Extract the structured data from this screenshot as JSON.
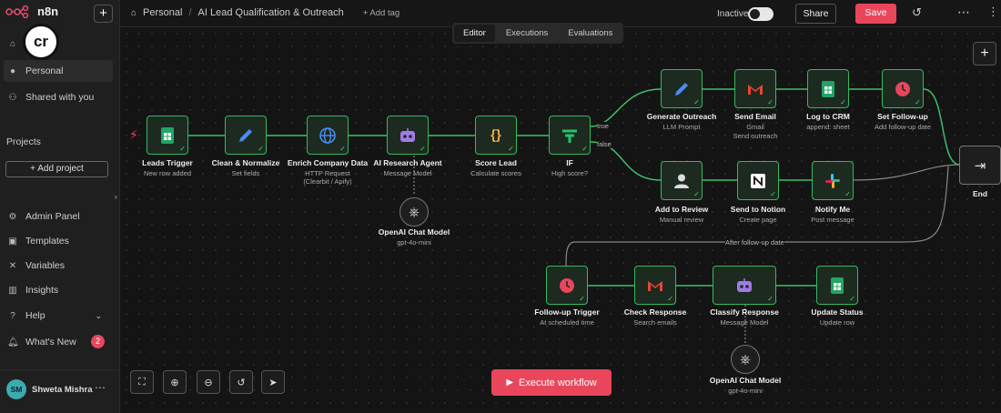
{
  "app": {
    "brand": "n8n",
    "avatar_initials": "cr"
  },
  "sidebar": {
    "items": [
      {
        "label": "",
        "icon": "home-icon"
      },
      {
        "label": "Personal",
        "icon": "user-icon"
      },
      {
        "label": "Shared with you",
        "icon": "users-icon"
      }
    ],
    "projects_heading": "Projects",
    "add_project": "+ Add project",
    "bottom_items": [
      {
        "label": "Admin Panel",
        "icon": "gear-icon"
      },
      {
        "label": "Templates",
        "icon": "template-icon"
      },
      {
        "label": "Variables",
        "icon": "variables-icon"
      },
      {
        "label": "Insights",
        "icon": "insights-icon"
      },
      {
        "label": "Help",
        "icon": "help-icon"
      },
      {
        "label": "What's New",
        "icon": "bell-icon"
      }
    ],
    "whats_new_count": "2",
    "user": {
      "initials": "SM",
      "name": "Shweta Mishra"
    }
  },
  "header": {
    "breadcrumb_project": "Personal",
    "breadcrumb_sep": "/",
    "workflow_name": "AI Lead Qualification & Outreach",
    "add_tag": "+ Add tag",
    "status": "Inactive",
    "share": "Share",
    "save": "Save"
  },
  "tabs": [
    "Editor",
    "Executions",
    "Evaluations"
  ],
  "nodes": [
    {
      "id": "leads",
      "label": "Leads Trigger",
      "sub": "New row added",
      "icon": "sheets-icon"
    },
    {
      "id": "clean",
      "label": "Clean & Normalize",
      "sub": "Set fields",
      "icon": "pencil-icon"
    },
    {
      "id": "enrich",
      "label": "Enrich Company Data",
      "sub": "HTTP Request",
      "sub2": "(Clearbit / Apify)",
      "icon": "globe-icon"
    },
    {
      "id": "agent",
      "label": "AI Research Agent",
      "sub": "Message Model",
      "icon": "robot-icon"
    },
    {
      "id": "score",
      "label": "Score Lead",
      "sub": "Calculate scores",
      "icon": "code-icon"
    },
    {
      "id": "if",
      "label": "IF",
      "sub": "High score?",
      "icon": "if-icon"
    },
    {
      "id": "gen",
      "label": "Generate Outreach",
      "sub": "LLM Prompt",
      "icon": "pencil-icon"
    },
    {
      "id": "email",
      "label": "Send Email",
      "sub": "Gmail",
      "sub2": "Send outreach",
      "icon": "gmail-icon"
    },
    {
      "id": "crm",
      "label": "Log to CRM",
      "sub": "append: sheet",
      "icon": "sheets-icon"
    },
    {
      "id": "follow",
      "label": "Set Follow-up",
      "sub": "Add follow-up date",
      "icon": "clock-icon"
    },
    {
      "id": "review",
      "label": "Add to Review",
      "sub": "Manual review",
      "icon": "person-icon"
    },
    {
      "id": "notion",
      "label": "Send to Notion",
      "sub": "Create page",
      "icon": "notion-icon"
    },
    {
      "id": "notify",
      "label": "Notify Me",
      "sub": "Post message",
      "icon": "slack-icon"
    },
    {
      "id": "end",
      "label": "End",
      "sub": "",
      "icon": "exit-icon"
    },
    {
      "id": "fut",
      "label": "Follow-up Trigger",
      "sub": "At scheduled time",
      "icon": "clock-icon"
    },
    {
      "id": "check",
      "label": "Check Response",
      "sub": "Search emails",
      "icon": "gmail-icon"
    },
    {
      "id": "classify",
      "label": "Classify Response",
      "sub": "Message Model",
      "icon": "robot-icon"
    },
    {
      "id": "update",
      "label": "Update Status",
      "sub": "Update row",
      "icon": "sheets-icon"
    },
    {
      "id": "oai1",
      "label": "OpenAI Chat Model",
      "sub": "gpt-4o-mini",
      "icon": "openai-icon"
    },
    {
      "id": "oai2",
      "label": "OpenAI Chat Model",
      "sub": "gpt-4o-mini",
      "icon": "openai-icon"
    }
  ],
  "edge_labels": {
    "true": "true",
    "false": "false",
    "after_follow": "After follow-up date"
  },
  "toolbar": {
    "execute": "Execute workflow"
  }
}
